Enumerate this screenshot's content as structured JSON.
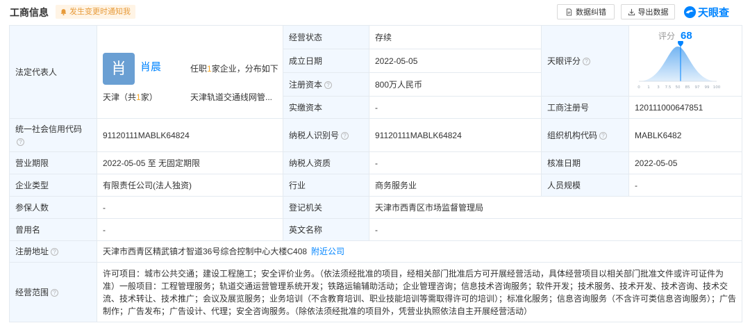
{
  "header": {
    "title": "工商信息",
    "notify_label": "发生变更时通知我",
    "correct_label": "数据纠错",
    "export_label": "导出数据",
    "logo_text": "天眼查"
  },
  "colors": {
    "accent": "#0084ff",
    "label_bg": "#f2f8ff",
    "highlight": "#f5a623",
    "avatar": "#6a9fd3"
  },
  "rep": {
    "label": "法定代表人",
    "avatar_char": "肖",
    "name": "肖晨",
    "desc_pre": "任职",
    "desc_num": "1",
    "desc_post": "家企业，分布如下",
    "region_pre": "天津（共",
    "region_num": "1",
    "region_post": "家）",
    "company": "天津轨道交通线网管..."
  },
  "fields": {
    "status_label": "经营状态",
    "status_value": "存续",
    "found_label": "成立日期",
    "found_value": "2022-05-05",
    "capital_label": "注册资本",
    "capital_value": "800万人民币",
    "paid_label": "实缴资本",
    "paid_value": "-",
    "score_label": "天眼评分",
    "regno_label": "工商注册号",
    "regno_value": "120111000647851",
    "credit_label": "统一社会信用代码",
    "credit_value": "91120111MABLK64824",
    "taxid_label": "纳税人识别号",
    "taxid_value": "91120111MABLK64824",
    "orgcode_label": "组织机构代码",
    "orgcode_value": "MABLK6482",
    "term_label": "营业期限",
    "term_value": "2022-05-05 至 无固定期限",
    "taxqual_label": "纳税人资质",
    "taxqual_value": "-",
    "approve_label": "核准日期",
    "approve_value": "2022-05-05",
    "type_label": "企业类型",
    "type_value": "有限责任公司(法人独资)",
    "industry_label": "行业",
    "industry_value": "商务服务业",
    "staff_label": "人员规模",
    "staff_value": "-",
    "insured_label": "参保人数",
    "insured_value": "-",
    "authority_label": "登记机关",
    "authority_value": "天津市西青区市场监督管理局",
    "former_label": "曾用名",
    "former_value": "-",
    "english_label": "英文名称",
    "english_value": "-",
    "address_label": "注册地址",
    "address_value": "天津市西青区精武镇才智道36号综合控制中心大楼C408",
    "nearby_label": "附近公司",
    "scope_label": "经营范围",
    "scope_value": "许可项目：城市公共交通；建设工程施工；安全评价业务。（依法须经批准的项目，经相关部门批准后方可开展经营活动，具体经营项目以相关部门批准文件或许可证件为准）一般项目：工程管理服务；轨道交通运营管理系统开发；铁路运输辅助活动；企业管理咨询；信息技术咨询服务；软件开发；技术服务、技术开发、技术咨询、技术交流、技术转让、技术推广；会议及展览服务；业务培训（不含教育培训、职业技能培训等需取得许可的培训）；标准化服务；信息咨询服务（不含许可类信息咨询服务）；广告制作；广告发布；广告设计、代理；安全咨询服务。（除依法须经批准的项目外，凭营业执照依法自主开展经营活动）"
  },
  "score": {
    "label": "评分",
    "value": "68",
    "ticks": [
      "0",
      "1",
      "3",
      "7.5",
      "50",
      "85",
      "97",
      "99",
      "100"
    ]
  }
}
